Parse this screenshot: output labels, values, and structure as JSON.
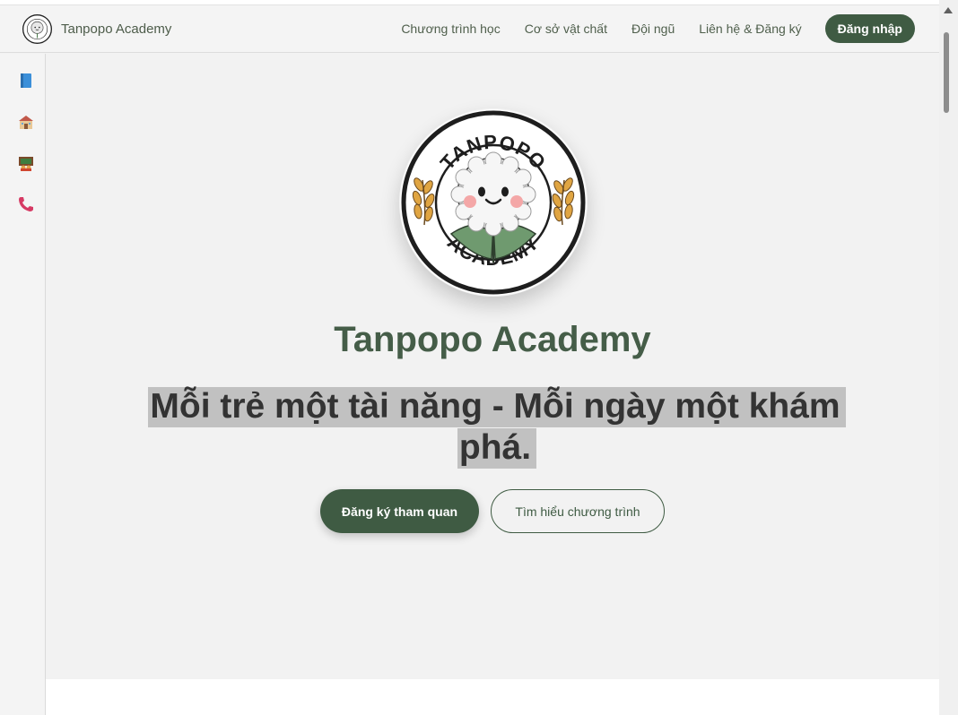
{
  "header": {
    "brand_name": "Tanpopo Academy",
    "nav": [
      "Chương trình học",
      "Cơ sở vật chất",
      "Đội ngũ",
      "Liên hệ & Đăng ký"
    ],
    "login_label": "Đăng nhập"
  },
  "sidebar": {
    "items": [
      "book-icon",
      "school-icon",
      "classroom-icon",
      "phone-icon"
    ]
  },
  "hero": {
    "logo_top_text": "TANPOPO",
    "logo_bottom_text": "ACADEMY",
    "title": "Tanpopo Academy",
    "tagline_line1": "Mỗi trẻ một tài năng - Mỗi ngày một khám",
    "tagline_line2": "phá.",
    "primary_button": "Đăng ký tham quan",
    "secondary_button": "Tìm hiểu chương trình"
  },
  "colors": {
    "brand_green": "#3f5b43",
    "title_green": "#455d48",
    "background": "#f2f2f2",
    "highlight": "#c1c1c1"
  }
}
